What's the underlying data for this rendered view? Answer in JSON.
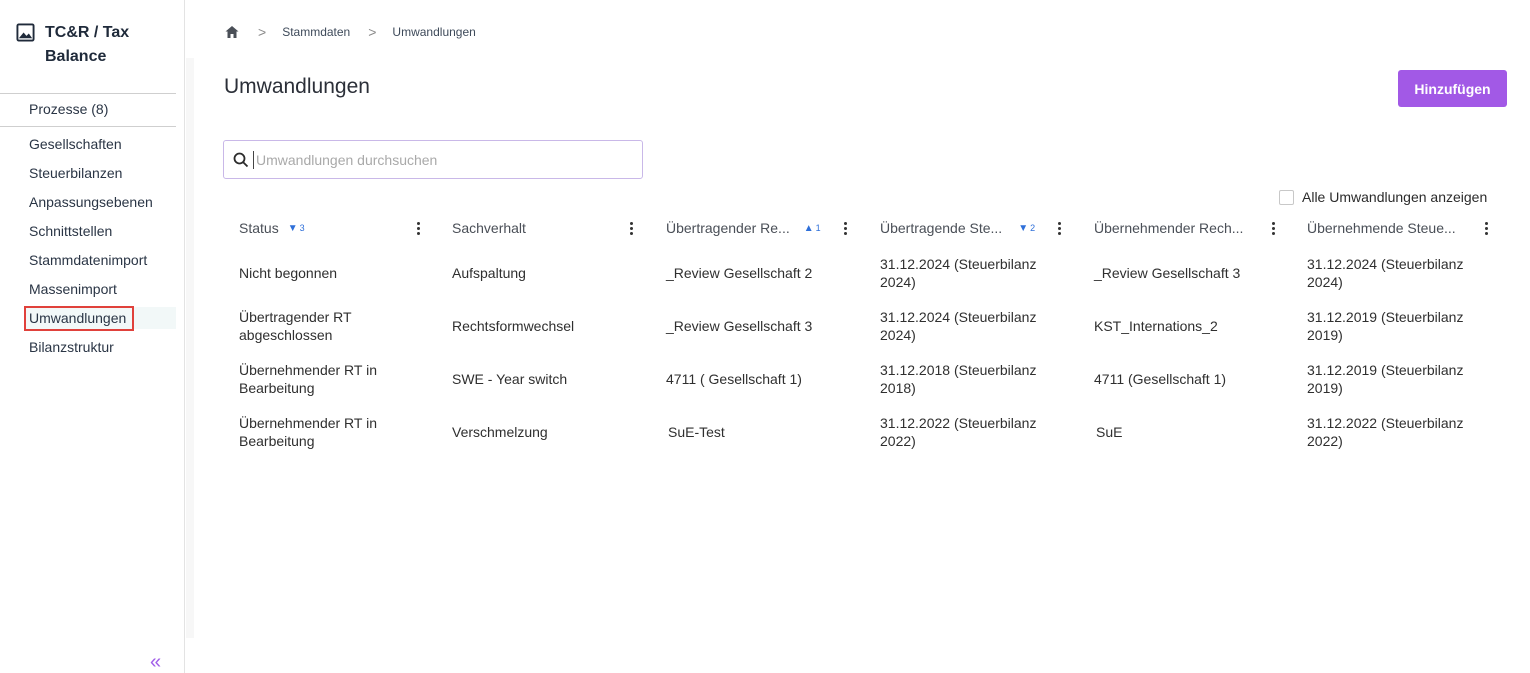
{
  "app": {
    "title": "TC&R / Tax Balance",
    "icon": "image-icon"
  },
  "sidebar": {
    "process_item": "Prozesse (8)",
    "items": [
      {
        "label": "Gesellschaften"
      },
      {
        "label": "Steuerbilanzen"
      },
      {
        "label": "Anpassungsebenen"
      },
      {
        "label": "Schnittstellen"
      },
      {
        "label": "Stammdatenimport"
      },
      {
        "label": "Massenimport"
      },
      {
        "label": "Umwandlungen",
        "active": true
      },
      {
        "label": "Bilanzstruktur"
      }
    ],
    "collapse_icon": "double-chevron-left-icon",
    "collapse_glyph": "«"
  },
  "breadcrumb": {
    "home_icon": "home-icon",
    "items": [
      "Stammdaten",
      "Umwandlungen"
    ],
    "separator": ">"
  },
  "page": {
    "title": "Umwandlungen",
    "add_button": "Hinzufügen"
  },
  "search": {
    "placeholder": "Umwandlungen durchsuchen",
    "value": ""
  },
  "filter": {
    "show_all_label": "Alle Umwandlungen anzeigen",
    "checked": false
  },
  "table": {
    "columns": [
      {
        "label": "Status",
        "sort": "desc",
        "sort_order": "3"
      },
      {
        "label": "Sachverhalt",
        "sort": null,
        "sort_order": ""
      },
      {
        "label": "Übertragender Re...",
        "sort": "asc",
        "sort_order": "1"
      },
      {
        "label": "Übertragende Ste...",
        "sort": "desc",
        "sort_order": "2"
      },
      {
        "label": "Übernehmender Rech...",
        "sort": null,
        "sort_order": ""
      },
      {
        "label": "Übernehmende Steue...",
        "sort": null,
        "sort_order": ""
      }
    ],
    "rows": [
      [
        "Nicht begonnen",
        "Aufspaltung",
        "_Review Gesellschaft 2",
        "31.12.2024 (Steuerbilanz 2024)",
        "_Review Gesellschaft 3",
        "31.12.2024 (Steuerbilanz 2024)"
      ],
      [
        "Übertragender RT abgeschlossen",
        "Rechtsformwechsel",
        "_Review Gesellschaft 3",
        "31.12.2024 (Steuerbilanz 2024)",
        "KST_Internations_2",
        "31.12.2019 (Steuerbilanz 2019)"
      ],
      [
        "Übernehmender RT in Bearbeitung",
        "SWE - Year switch",
        "4711 ( Gesellschaft 1)",
        "31.12.2018 (Steuerbilanz 2018)",
        "4711 (Gesellschaft 1)",
        "31.12.2019 (Steuerbilanz 2019)"
      ],
      [
        "Übernehmender RT in Bearbeitung",
        "Verschmelzung",
        "SuE-Test",
        "31.12.2022 (Steuerbilanz 2022)",
        "SuE",
        "31.12.2022 (Steuerbilanz 2022)"
      ]
    ]
  },
  "colors": {
    "accent": "#a259e6",
    "sort_indicator": "#2e6fd9",
    "highlight_box": "#e0413b"
  }
}
